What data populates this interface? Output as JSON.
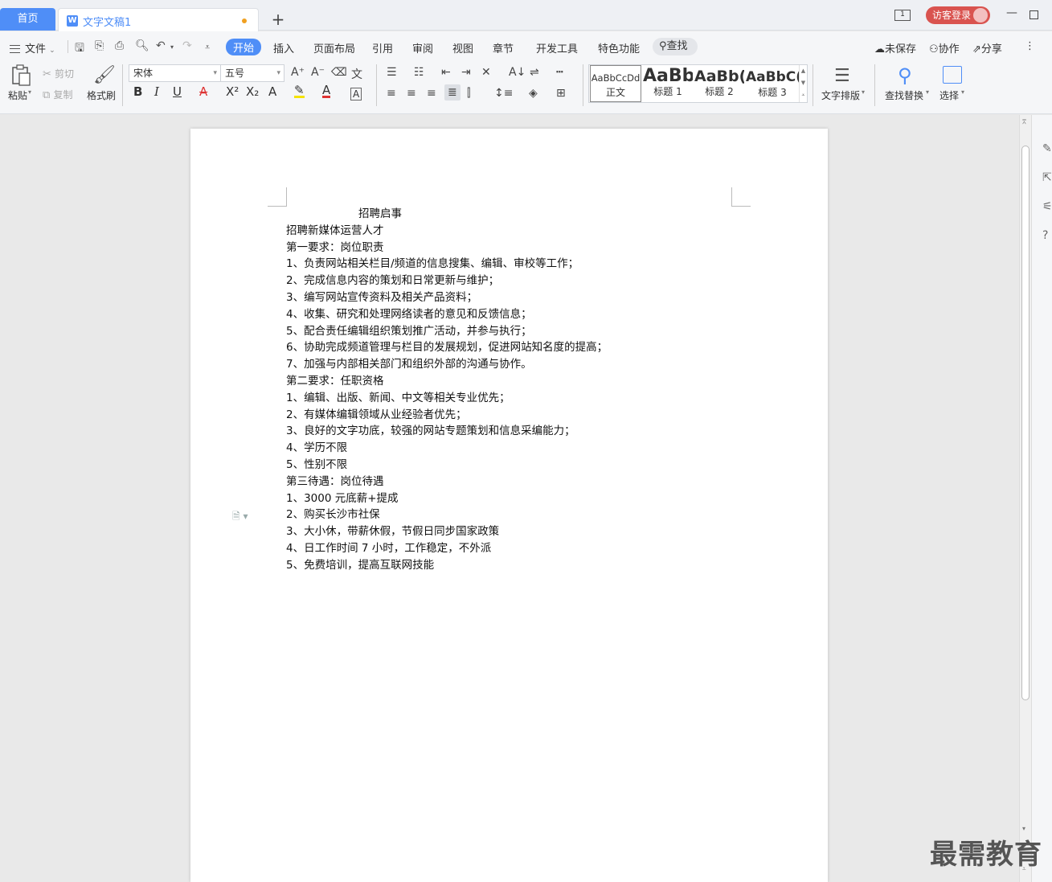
{
  "tabs": {
    "home": "首页",
    "doc_title": "文字文稿1",
    "doc_icon": "W",
    "add": "+"
  },
  "window": {
    "badge": "1",
    "login": "访客登录"
  },
  "menu": {
    "file": "文件",
    "tabs": [
      "开始",
      "插入",
      "页面布局",
      "引用",
      "审阅",
      "视图",
      "章节",
      "开发工具",
      "特色功能"
    ],
    "active_tab": "开始",
    "search": "查找",
    "unsaved": "未保存",
    "collab": "协作",
    "share": "分享"
  },
  "ribbon": {
    "paste": "粘贴",
    "cut": "剪切",
    "copy": "复制",
    "format_painter": "格式刷",
    "font_name": "宋体",
    "font_size": "五号",
    "styles": [
      {
        "sample": "AaBbCcDd",
        "name": "正文"
      },
      {
        "sample": "AaBb",
        "name": "标题 1"
      },
      {
        "sample": "AaBb(",
        "name": "标题 2"
      },
      {
        "sample": "AaBbC(",
        "name": "标题 3"
      }
    ],
    "text_layout": "文字排版",
    "find_replace": "查找替换",
    "select": "选择"
  },
  "document": {
    "lines": [
      "招聘启事",
      "招聘新媒体运营人才",
      "第一要求：岗位职责",
      "1、负责网站相关栏目/频道的信息搜集、编辑、审校等工作；",
      "2、完成信息内容的策划和日常更新与维护；",
      "3、编写网站宣传资料及相关产品资料；",
      "4、收集、研究和处理网络读者的意见和反馈信息；",
      "5、配合责任编辑组织策划推广活动，并参与执行；",
      "6、协助完成频道管理与栏目的发展规划，促进网站知名度的提高；",
      "7、加强与内部相关部门和组织外部的沟通与协作。",
      "第二要求：任职资格",
      "1、编辑、出版、新闻、中文等相关专业优先；",
      "2、有媒体编辑领域从业经验者优先；",
      "3、良好的文字功底，较强的网站专题策划和信息采编能力；",
      "4、学历不限",
      "5、性别不限",
      "第三待遇：岗位待遇",
      "1、3000 元底薪+提成",
      "2、购买长沙市社保",
      "3、大小休，带薪休假，节假日同步国家政策",
      "4、日工作时间 7 小时，工作稳定，不外派",
      "5、免费培训，提高互联网技能"
    ]
  },
  "watermark": "最需教育"
}
